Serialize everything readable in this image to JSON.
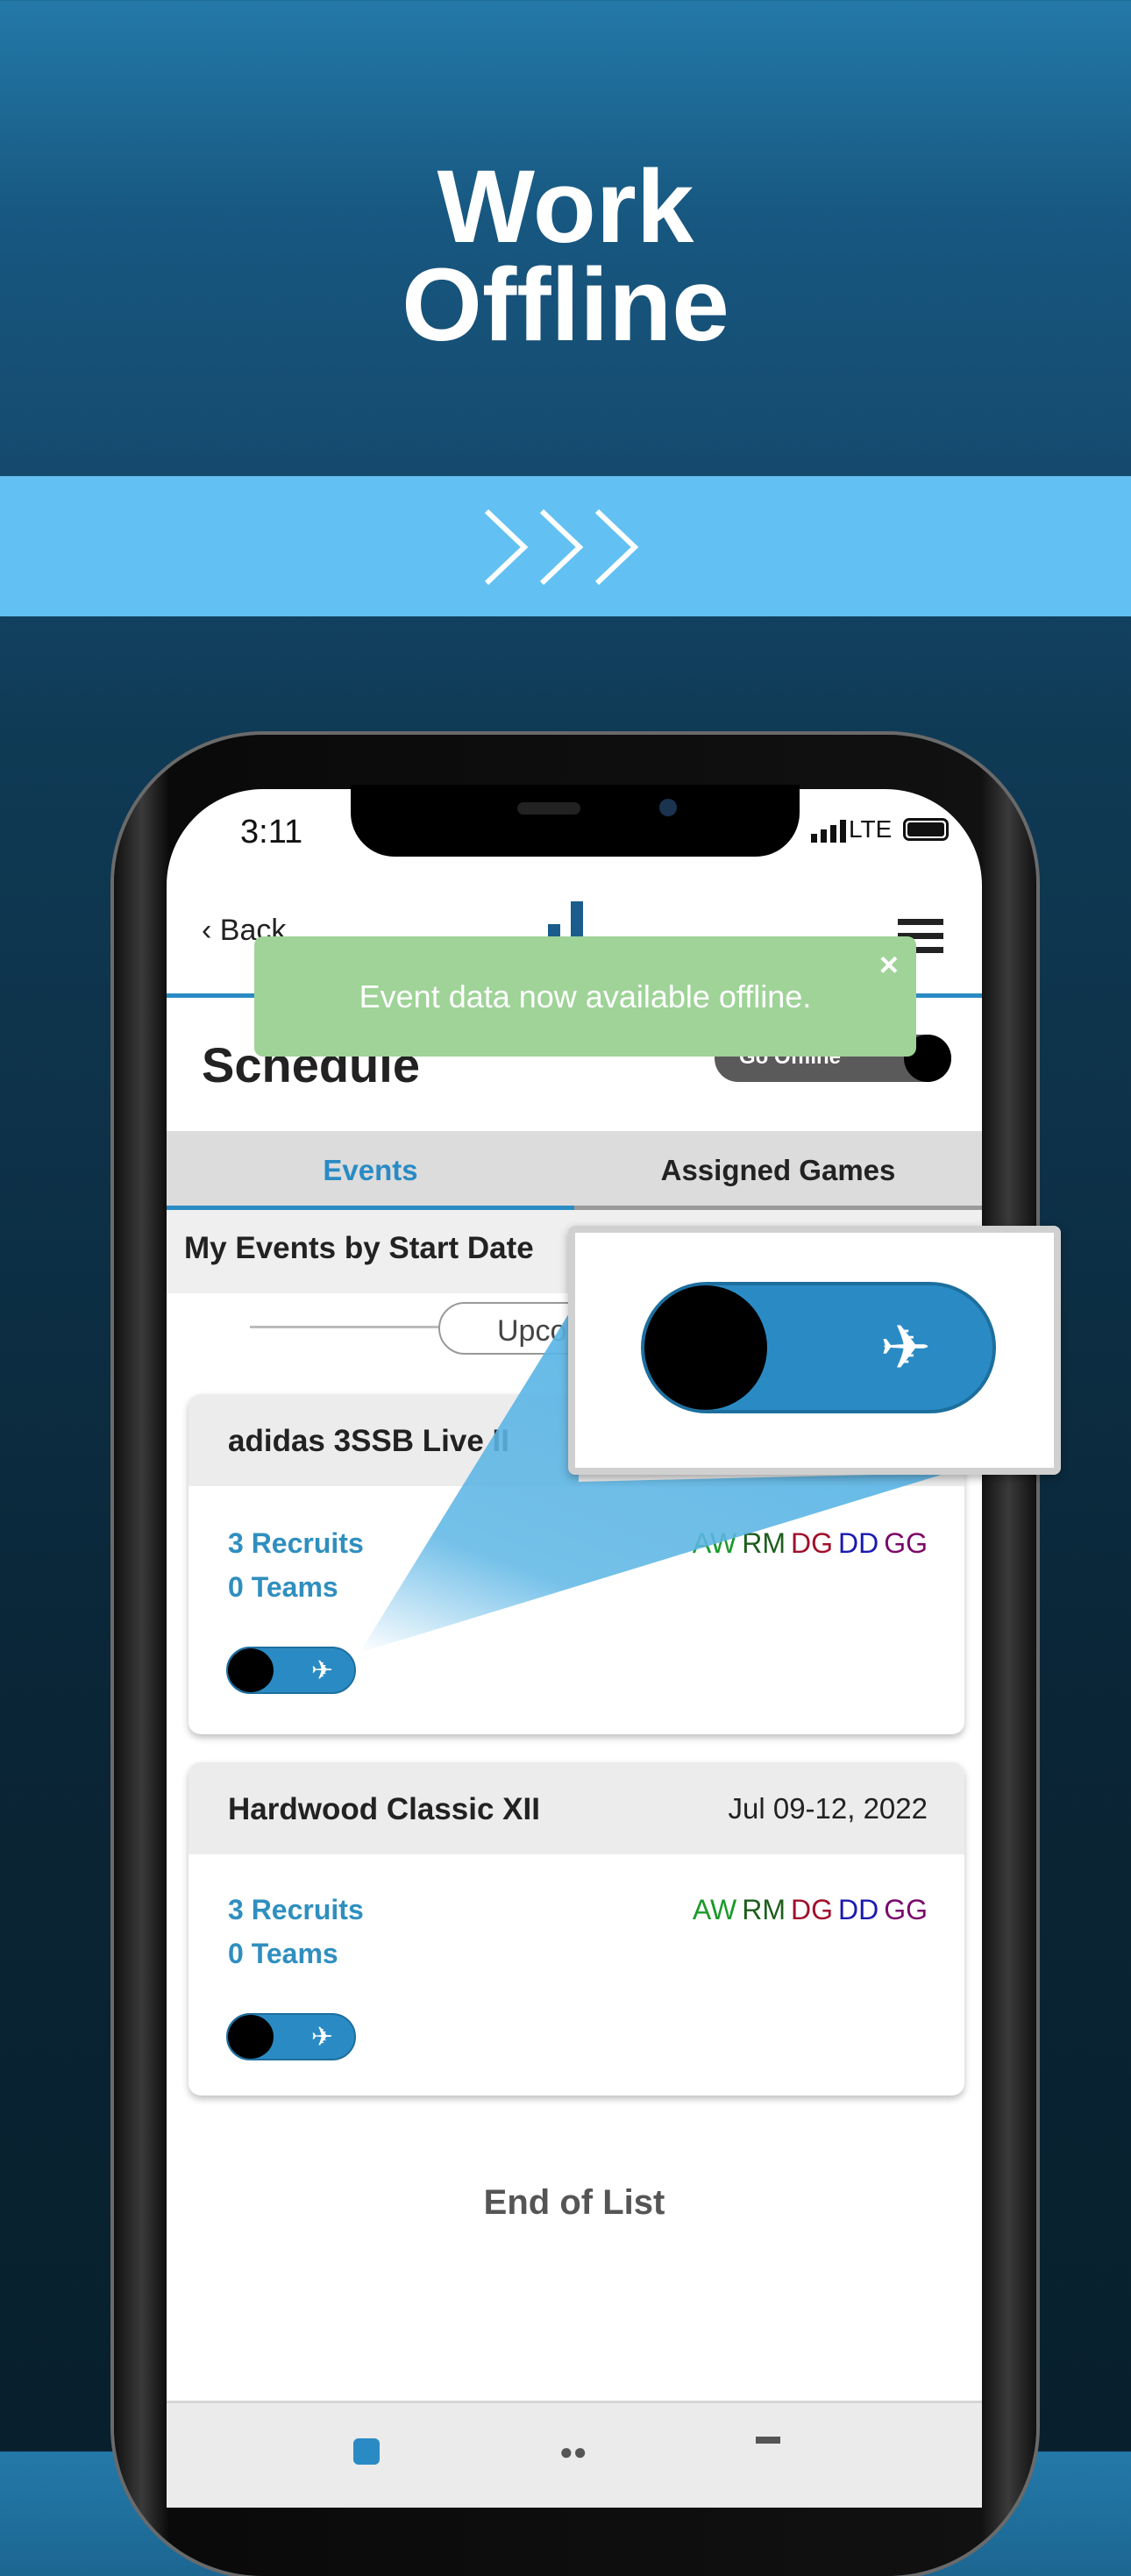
{
  "hero": {
    "title_line1": "Work",
    "title_line2": "Offline"
  },
  "colors": {
    "accent": "#2a8bc4",
    "band": "#62c1f2",
    "toast": "#9fd398"
  },
  "status_bar": {
    "time": "3:11",
    "network": "LTE"
  },
  "header": {
    "back_label": "Back",
    "menu_icon": "hamburger-icon"
  },
  "toast": {
    "message": "Event data now available offline.",
    "close": "×"
  },
  "page": {
    "title": "Schedule",
    "go_offline_label": "Go Offline"
  },
  "tabs": [
    {
      "label": "Events",
      "active": true
    },
    {
      "label": "Assigned Games",
      "active": false
    }
  ],
  "section": {
    "title": "My Events by Start Date",
    "filter_label": "Upcoming"
  },
  "events": [
    {
      "name": "adidas 3SSB Live II",
      "date": "",
      "recruits": "3 Recruits",
      "teams": "0 Teams",
      "initials": [
        "AW",
        "RM",
        "DG",
        "DD",
        "GG"
      ],
      "offline": true
    },
    {
      "name": "Hardwood Classic XII",
      "date": "Jul 09-12, 2022",
      "recruits": "3 Recruits",
      "teams": "0 Teams",
      "initials": [
        "AW",
        "RM",
        "DG",
        "DD",
        "GG"
      ],
      "offline": true
    }
  ],
  "initial_colors": [
    "#1a9a2a",
    "#1e5e1e",
    "#a0102c",
    "#1a1ab0",
    "#7a0a6a"
  ],
  "end_label": "End of List",
  "bottom_nav": [
    {
      "icon": "calendar-icon"
    },
    {
      "icon": "people-icon"
    },
    {
      "icon": "menu-icon"
    }
  ]
}
